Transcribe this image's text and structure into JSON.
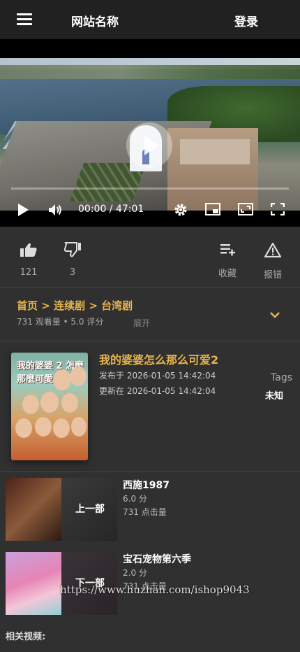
{
  "header": {
    "menu_icon": "hamburger-menu-icon",
    "site_title": "网站名称",
    "login_label": "登录"
  },
  "player": {
    "time_display": "00:00 / 47:01",
    "progress": 0,
    "icons": [
      "play-icon",
      "volume-icon",
      "settings-icon",
      "picture-in-picture-icon",
      "theater-mode-icon",
      "fullscreen-icon"
    ]
  },
  "actions": {
    "like_count": "121",
    "dislike_count": "3",
    "favorite_label": "收藏",
    "report_label": "报错"
  },
  "info": {
    "breadcrumb": [
      "首页",
      "连续剧",
      "台湾剧"
    ],
    "separator": ">",
    "stats": "731 观看量 • 5.0 评分",
    "expand_label": "展开"
  },
  "detail": {
    "title": "我的婆婆怎么那么可爱2",
    "poster_title": "我的婆婆 2 怎麼那麼可愛",
    "published": "发布于 2026-01-05 14:42:04",
    "updated": "更新在 2026-01-05 14:42:04",
    "tags_label": "Tags",
    "tags_value": "未知"
  },
  "prev": {
    "nav_label": "上一部",
    "title": "西施1987",
    "score": "6.0 分",
    "clicks": "731 点击量"
  },
  "next": {
    "nav_label": "下一部",
    "title": "宝石宠物第六季",
    "score": "2.0 分",
    "clicks": "731 点击量"
  },
  "watermark": "https://www.huzhan.com/ishop9043",
  "related_label": "相关视频:",
  "colors": {
    "accent": "#e8b44c",
    "background": "#303030",
    "header": "#212121"
  }
}
